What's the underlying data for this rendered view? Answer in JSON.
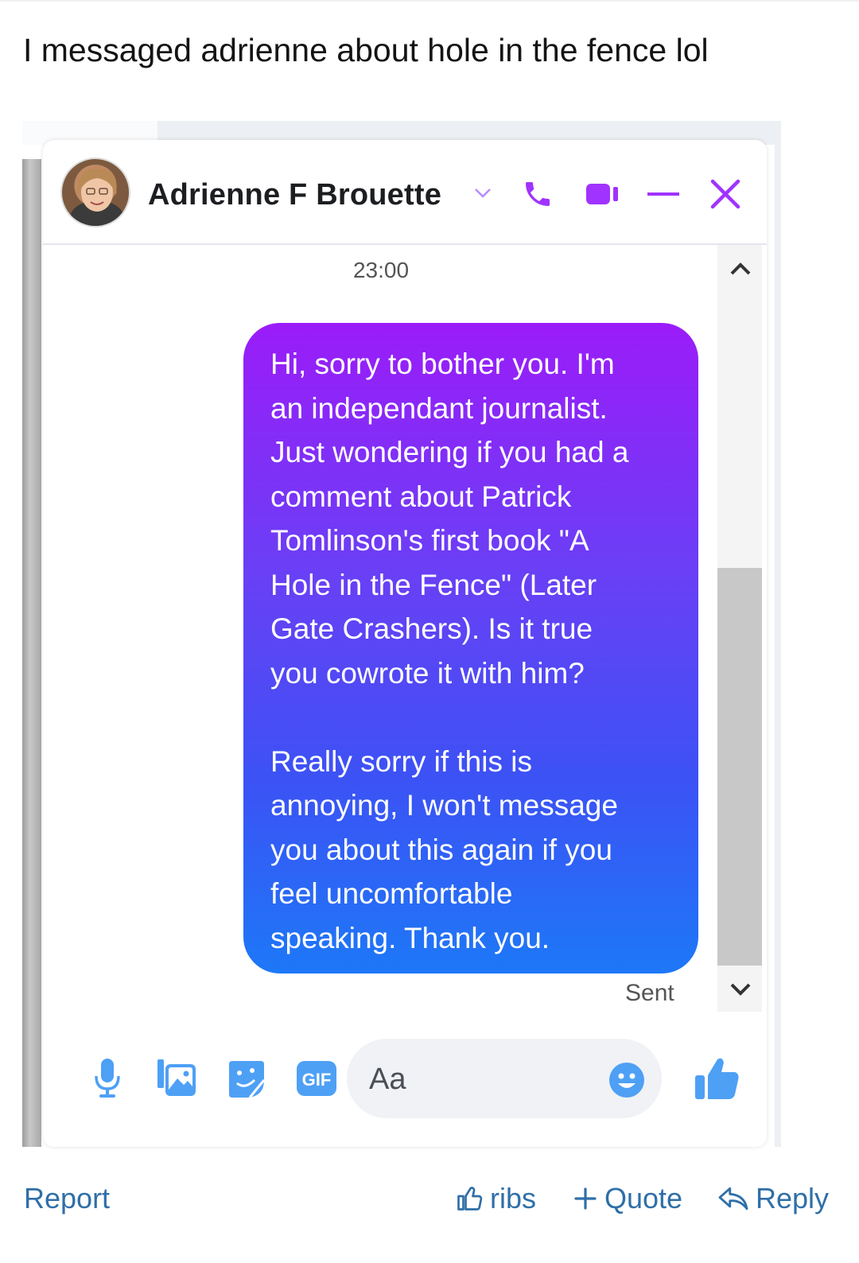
{
  "post": {
    "text": "I messaged adrienne about hole in the fence lol"
  },
  "messenger": {
    "contact_name": "Adrienne F Brouette",
    "timestamp": "23:00",
    "message": "Hi, sorry to bother you. I'm\nan independant journalist.\nJust wondering if you had a\ncomment about Patrick\nTomlinson's first book \"A\nHole in the Fence\" (Later\nGate Crashers). Is it true\nyou cowrote it with him?\n\nReally sorry if this is\nannoying, I won't message\nyou about this again if you\nfeel uncomfortable\nspeaking. Thank you.",
    "status": "Sent",
    "input_placeholder": "Aa",
    "gif_label": "GIF",
    "colors": {
      "accent": "#a033ff",
      "composer_blue": "#4ea0f5",
      "bubble_top": "#9b1cf9",
      "bubble_bottom": "#1d78f7"
    },
    "header_icons": [
      "chevron-down-icon",
      "phone-icon",
      "video-icon",
      "minimize-icon",
      "close-icon"
    ],
    "composer_icons": [
      "microphone-icon",
      "photo-icon",
      "sticker-icon",
      "gif-icon",
      "emoji-icon",
      "thumbs-up-icon"
    ]
  },
  "footer": {
    "report": "Report",
    "reaction": "ribs",
    "quote": "Quote",
    "reply": "Reply"
  }
}
